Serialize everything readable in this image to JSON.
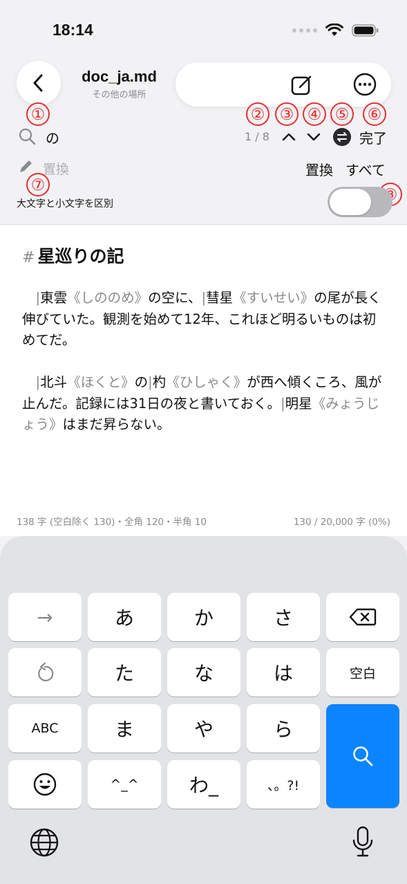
{
  "status": {
    "time": "18:14"
  },
  "header": {
    "title": "doc_ja.md",
    "subtitle": "その他の場所"
  },
  "annotations": [
    "①",
    "②",
    "③",
    "④",
    "⑤",
    "⑥",
    "⑦",
    "⑧"
  ],
  "find": {
    "query": "の",
    "count": "1 / 8",
    "done_label": "完了"
  },
  "replace": {
    "placeholder": "置換",
    "replace_label": "置換",
    "all_label": "すべて"
  },
  "options": {
    "case_label": "大文字と小文字を区別",
    "case_sensitive": false
  },
  "document": {
    "hash": "#",
    "heading": "星巡りの記",
    "p1": [
      {
        "t": "　",
        "c": "txt"
      },
      {
        "t": "|",
        "c": "bar"
      },
      {
        "t": "東雲",
        "c": "txt"
      },
      {
        "t": "《しののめ》",
        "c": "ruby"
      },
      {
        "t": "の空に、",
        "c": "txt"
      },
      {
        "t": "|",
        "c": "bar"
      },
      {
        "t": "彗星",
        "c": "txt"
      },
      {
        "t": "《すいせい》",
        "c": "ruby"
      },
      {
        "t": "の尾が長く伸びていた。観測を始めて12年、これほど明るいものは初めてだ。",
        "c": "txt"
      }
    ],
    "p2": [
      {
        "t": "　",
        "c": "txt"
      },
      {
        "t": "|",
        "c": "bar"
      },
      {
        "t": "北斗",
        "c": "txt"
      },
      {
        "t": "《ほくと》",
        "c": "ruby"
      },
      {
        "t": "の",
        "c": "txt"
      },
      {
        "t": "|",
        "c": "bar"
      },
      {
        "t": "杓",
        "c": "txt"
      },
      {
        "t": "《ひしゃく》",
        "c": "ruby"
      },
      {
        "t": "が西へ傾くころ、風が止んだ。記録には31日の夜と書いておく。",
        "c": "txt"
      },
      {
        "t": "|",
        "c": "bar"
      },
      {
        "t": "明星",
        "c": "txt"
      },
      {
        "t": "《みょうじょう》",
        "c": "ruby"
      },
      {
        "t": "はまだ昇らない。",
        "c": "txt"
      }
    ],
    "stats_left": "138 字 (空白除く 130)・全角 120・半角 10",
    "stats_right": "130 / 20,000 字 (0%)"
  },
  "keyboard": {
    "rows": [
      [
        "→",
        "あ",
        "か",
        "さ",
        "⌫"
      ],
      [
        "↺",
        "た",
        "な",
        "は",
        "空白"
      ],
      [
        "ABC",
        "ま",
        "や",
        "ら",
        ""
      ],
      [
        "☺",
        "^_^",
        "わ_",
        "、。?!",
        ""
      ]
    ],
    "icons": [
      "globe-icon",
      "microphone-icon",
      "search-icon",
      "backspace-icon",
      "undo-icon",
      "emoji-icon"
    ]
  }
}
